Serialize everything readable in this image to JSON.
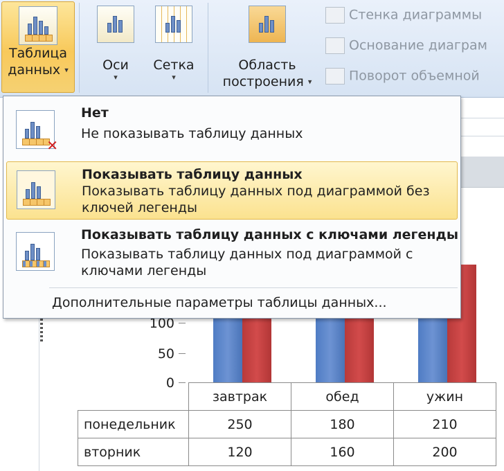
{
  "ribbon": {
    "table_button": {
      "line1": "Таблица",
      "line2": "данных"
    },
    "axes_button": {
      "label": "Оси"
    },
    "grid_button": {
      "label": "Сетка"
    },
    "plot_area_button": {
      "line1": "Область",
      "line2": "построения"
    },
    "chart_wall": {
      "label": "Стенка диаграммы"
    },
    "chart_floor": {
      "label": "Основание диаграм"
    },
    "rotation_3d": {
      "label": "Поворот объемной"
    }
  },
  "menu": {
    "items": [
      {
        "title": "Нет",
        "desc": "Не показывать таблицу данных",
        "icon": "no-data-table-icon"
      },
      {
        "title": "Показывать таблицу данных",
        "desc": "Показывать таблицу данных под диаграммой без ключей легенды",
        "icon": "data-table-icon",
        "selected": true
      },
      {
        "title": "Показывать таблицу данных с ключами легенды",
        "desc": "Показывать таблицу данных под диаграммой с ключами легенды",
        "icon": "data-table-legend-keys-icon"
      }
    ],
    "more_options": "Дополнительные параметры таблицы данных..."
  },
  "chart": {
    "y_ticks": [
      "100",
      "50",
      "0"
    ],
    "colors": {
      "series1": "#4f7cc4",
      "series2": "#c94444"
    },
    "columns": [
      "завтрак",
      "обед",
      "ужин"
    ],
    "rows": [
      {
        "label": "понедельник",
        "values": [
          "250",
          "180",
          "210"
        ]
      },
      {
        "label": "вторник",
        "values": [
          "120",
          "160",
          "200"
        ]
      }
    ]
  }
}
